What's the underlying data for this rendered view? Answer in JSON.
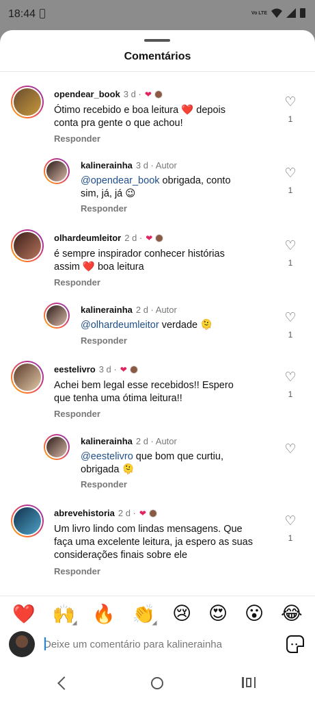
{
  "status_bar": {
    "time": "18:44",
    "network": "Vo LTE"
  },
  "sheet": {
    "title": "Comentários"
  },
  "comments": [
    {
      "user": "opendear_book",
      "meta": "3 d ·",
      "text": "Ótimo recebido e boa leitura ❤️ depois conta pra gente o que achou!",
      "reply_label": "Responder",
      "likes": "1",
      "avatar_colors": [
        "#6a4b2f",
        "#c89a3c"
      ]
    },
    {
      "user": "kalinerainha",
      "meta": "3 d · Autor",
      "mention": "@opendear_book",
      "text": " obrigada, conto sim, já, já 😉",
      "reply_label": "Responder",
      "likes": "1",
      "avatar_colors": [
        "#2b1c18",
        "#d9b8a8"
      ]
    },
    {
      "user": "olhardeumleitor",
      "meta": "2 d ·",
      "text": "é sempre inspirador conhecer histórias assim ❤️ boa leitura",
      "reply_label": "Responder",
      "likes": "1",
      "avatar_colors": [
        "#3a1f1a",
        "#b8765d"
      ]
    },
    {
      "user": "kalinerainha",
      "meta": "2 d · Autor",
      "mention": "@olhardeumleitor",
      "text": " verdade 🫠",
      "reply_label": "Responder",
      "likes": "1",
      "avatar_colors": [
        "#2b1c18",
        "#d9b8a8"
      ]
    },
    {
      "user": "eestelivro",
      "meta": "3 d ·",
      "text": "Achei bem legal esse recebidos!! Espero que tenha uma ótima leitura!!",
      "reply_label": "Responder",
      "likes": "1",
      "avatar_colors": [
        "#5b3b2a",
        "#e3c9a9"
      ]
    },
    {
      "user": "kalinerainha",
      "meta": "2 d · Autor",
      "mention": "@eestelivro",
      "text": " que bom que curtiu, obrigada 🫠",
      "reply_label": "Responder",
      "likes": "",
      "avatar_colors": [
        "#2b1c18",
        "#d9b8a8"
      ]
    },
    {
      "user": "abrevehistoria",
      "meta": "2 d ·",
      "text": "Um livro lindo com lindas mensagens. Que faça uma excelente leitura, ja espero as suas considerações finais sobre ele",
      "reply_label": "Responder",
      "likes": "1",
      "avatar_colors": [
        "#10304a",
        "#4fa3c9"
      ]
    }
  ],
  "emoji_bar": [
    "❤️",
    "🙌",
    "🔥",
    "👏",
    "😢",
    "😍",
    "😮",
    "😂"
  ],
  "compose": {
    "placeholder": "Deixe um comentário para kalinerainha"
  }
}
